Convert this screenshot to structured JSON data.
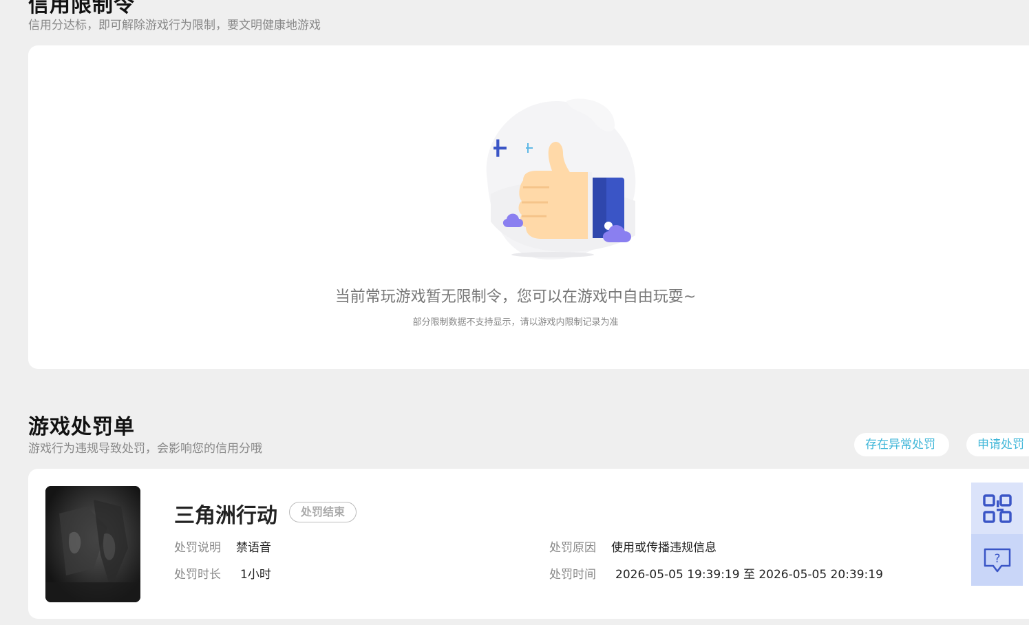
{
  "credit_section": {
    "title": "信用限制令",
    "subtitle": "信用分达标，即可解除游戏行为限制，要文明健康地游戏"
  },
  "restriction_empty": {
    "message": "当前常玩游戏暂无限制令，您可以在游戏中自由玩耍~",
    "note": "部分限制数据不支持显示，请以游戏内限制记录为准",
    "illustration_icon": "thumbs-up-icon"
  },
  "penalty_section": {
    "title": "游戏处罚单",
    "subtitle": "游戏行为违规导致处罚，会影响您的信用分哦",
    "actions": {
      "abnormal_label": "存在异常处罚",
      "appeal_label": "申请处罚"
    }
  },
  "penalty_record": {
    "game_name": "三角洲行动",
    "status": "处罚结束",
    "desc_label": "处罚说明",
    "desc_value": "禁语音",
    "reason_label": "处罚原因",
    "reason_value": "使用或传播违规信息",
    "duration_label": "处罚时长",
    "duration_value": "1小时",
    "time_label": "处罚时间",
    "time_value": "2026-05-05 19:39:19 至 2026-05-05 20:39:19"
  },
  "floating_tools": {
    "qr_icon": "qr-code-icon",
    "help_icon": "help-chat-icon"
  },
  "colors": {
    "background": "#efefef",
    "accent": "#3fb6d8",
    "float_qr_bg": "#dbe3fa",
    "float_help_bg": "#c9d6f8",
    "icon_blue": "#3a55c6"
  }
}
